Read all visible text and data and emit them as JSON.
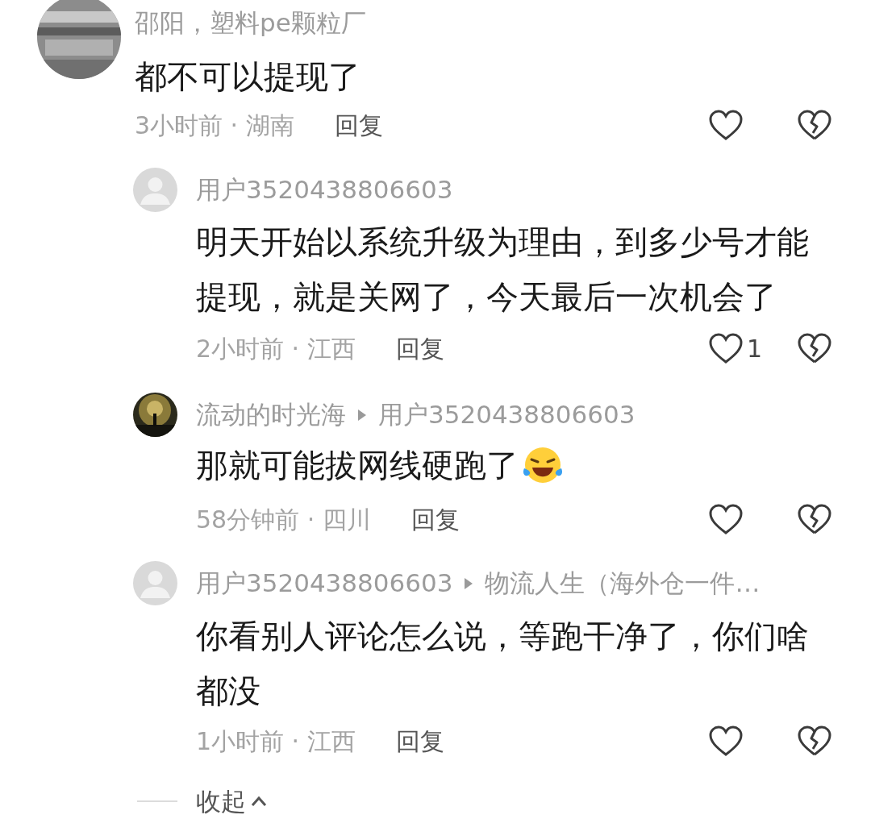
{
  "comment": {
    "author": "邵阳，塑料pe颗粒厂",
    "text": "都不可以提现了",
    "meta": "3小时前 · 湖南",
    "reply_label": "回复",
    "replies": [
      {
        "author": "用户3520438806603",
        "kind": "default",
        "text": "明天开始以系统升级为理由，到多少号才能提现，就是关网了，今天最后一次机会了",
        "meta": "2小时前 · 江西",
        "reply_label": "回复",
        "likes": "1"
      },
      {
        "author": "流动的时光海",
        "reply_to": "用户3520438806603",
        "kind": "picture",
        "text": "那就可能拔网线硬跑了",
        "emoji": true,
        "meta": "58分钟前 · 四川",
        "reply_label": "回复"
      },
      {
        "author": "用户3520438806603",
        "reply_to": "物流人生（海外仓一件…",
        "kind": "default",
        "text": "你看别人评论怎么说，等跑干净了，你们啥都没",
        "meta": "1小时前 · 江西",
        "reply_label": "回复"
      }
    ]
  },
  "collapse": {
    "label": "收起"
  }
}
